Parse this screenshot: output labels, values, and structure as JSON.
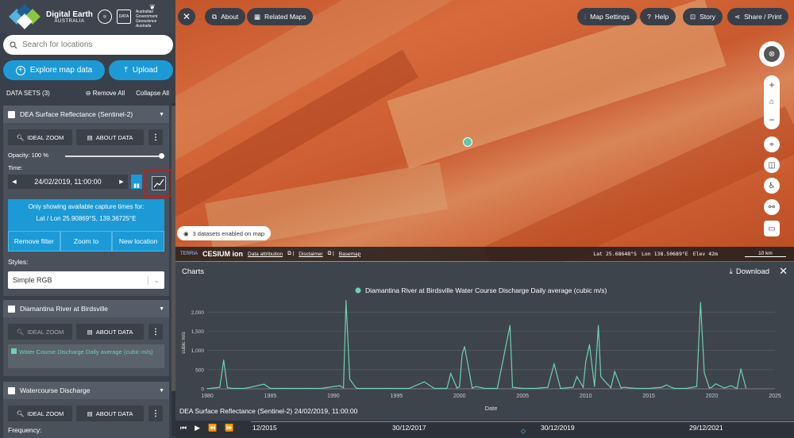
{
  "brand": {
    "title": "Digital Earth",
    "subtitle": "AUSTRALIA",
    "gov": "Australian Government",
    "agency": "Geoscience Australia"
  },
  "search": {
    "placeholder": "Search for locations"
  },
  "buttons": {
    "explore": "Explore map data",
    "upload": "Upload"
  },
  "datasets": {
    "header": "DATA SETS (3)",
    "remove_all": "Remove All",
    "collapse_all": "Collapse All"
  },
  "dea": {
    "title": "DEA Surface Reflectance (Sentinel-2)",
    "ideal_zoom": "IDEAL ZOOM",
    "about": "ABOUT DATA",
    "opacity": "Opacity: 100 %",
    "opacity_value": 1.0,
    "time_label": "Time:",
    "date": "24/02/2019, 11:00:00",
    "info_line1": "Only showing available capture times for:",
    "info_line2": "Lat / Lon 25.90869°S, 139.36725°E",
    "remove_filter": "Remove filter",
    "zoom_to": "Zoom to",
    "new_location": "New location",
    "styles_label": "Styles:",
    "style_value": "Simple RGB"
  },
  "diamantina": {
    "title": "Diamantina River at Birdsville",
    "ideal_zoom": "IDEAL ZOOM",
    "about": "ABOUT DATA",
    "legend": "Water Course Discharge Daily average (cubic m/s)"
  },
  "watercourse": {
    "title": "Watercourse Discharge",
    "ideal_zoom": "IDEAL ZOOM",
    "about": "ABOUT DATA",
    "frequency": "Frequency:"
  },
  "topbar": {
    "about": "About",
    "related": "Related Maps",
    "settings": "Map Settings",
    "help": "Help",
    "story": "Story",
    "share": "Share / Print"
  },
  "map": {
    "badge": "3 datasets enabled on map",
    "cesium": "CESIUM ion",
    "attribution": "Data attribution",
    "disclaimer": "Disclaimer",
    "basemap": "Basemap",
    "lat": "Lat  25.68648°S",
    "lon": "Lon  138.50689°E",
    "elev": "Elev  42m",
    "scale": "10 km"
  },
  "charts": {
    "title": "Charts",
    "download": "Download"
  },
  "chart_data": {
    "type": "line",
    "title": "Diamantina River at Birdsville Water Course Discharge Daily average (cubic m/s)",
    "xlabel": "Date",
    "ylabel": "cubic m/s",
    "xlim": [
      1980,
      2025
    ],
    "ylim": [
      0,
      2400
    ],
    "xticks": [
      "1980",
      "1985",
      "1990",
      "1995",
      "2000",
      "2005",
      "2010",
      "2015",
      "2020",
      "2025"
    ],
    "yticks": [
      "0",
      "500",
      "1,000",
      "1,500",
      "2,000"
    ],
    "color": "#6fd1ad",
    "x": [
      1980,
      1981,
      1981.3,
      1981.6,
      1982,
      1983,
      1984.5,
      1985,
      1986,
      1987,
      1988,
      1989,
      1990.5,
      1990.8,
      1991.0,
      1991.3,
      1991.8,
      1992,
      1993,
      1994,
      1995,
      1996,
      1997.2,
      1998,
      1999,
      1999.3,
      1999.8,
      2000,
      2000.2,
      2000.4,
      2001,
      2001.3,
      2002,
      2003,
      2004.0,
      2004.2,
      2005,
      2006,
      2007,
      2007.5,
      2008,
      2009,
      2009.3,
      2009.8,
      2010.0,
      2010.3,
      2010.7,
      2011.0,
      2011.2,
      2011.5,
      2012,
      2012.3,
      2012.8,
      2013,
      2014,
      2015,
      2016,
      2016.4,
      2017,
      2018,
      2018.8,
      2019.1,
      2019.4,
      2019.8,
      2020,
      2020.3,
      2021,
      2021.5,
      2022,
      2022.3,
      2022.7
    ],
    "y": [
      5,
      40,
      750,
      30,
      10,
      10,
      120,
      10,
      10,
      10,
      10,
      10,
      80,
      30,
      2300,
      250,
      20,
      10,
      10,
      10,
      10,
      10,
      180,
      10,
      10,
      400,
      20,
      60,
      900,
      1100,
      20,
      60,
      10,
      10,
      1650,
      40,
      10,
      10,
      40,
      650,
      10,
      40,
      320,
      40,
      700,
      1150,
      60,
      1650,
      320,
      200,
      30,
      450,
      20,
      40,
      10,
      10,
      40,
      100,
      10,
      10,
      60,
      2250,
      420,
      20,
      40,
      130,
      20,
      80,
      10,
      520,
      20
    ]
  },
  "footer": {
    "caption": "DEA Surface Reflectance (Sentinel-2) 24/02/2019, 11:00:00",
    "t1": "12/2015",
    "t2": "30/12/2017",
    "t3": "30/12/2019",
    "t4": "29/12/2021"
  }
}
